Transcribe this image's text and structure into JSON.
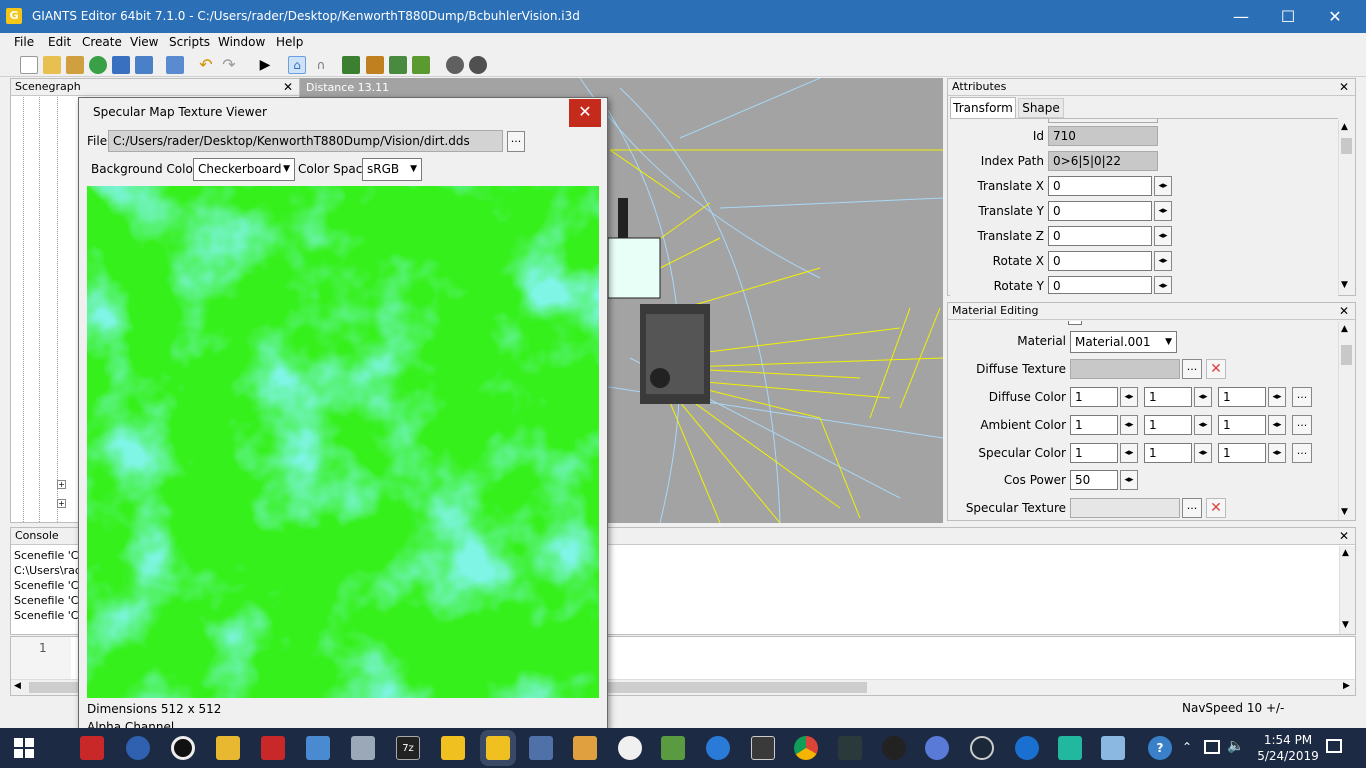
{
  "window": {
    "title": "GIANTS Editor 64bit 7.1.0 - C:/Users/rader/Desktop/KenworthT880Dump/BcbuhlerVision.i3d",
    "app_icon": "giants-logo-icon",
    "minimize": "—",
    "maximize": "☐",
    "close": "✕"
  },
  "menu": [
    "File",
    "Edit",
    "Create",
    "View",
    "Scripts",
    "Window",
    "Help"
  ],
  "toolbar": {
    "icons": [
      "new-file-icon",
      "open-folder-icon",
      "edit-icon",
      "refresh-icon",
      "save-icon",
      "export-icon",
      "import-icon",
      "undo-icon",
      "redo-icon",
      "play-icon",
      "home-icon",
      "magnet-icon",
      "terrain-icon",
      "paint-icon",
      "foliage-icon",
      "tree-icon",
      "camera-icon",
      "settings-icon"
    ]
  },
  "scenegraph": {
    "title": "Scenegraph",
    "close": "✕"
  },
  "viewport": {
    "distance_label": "Distance 13.11"
  },
  "attributes": {
    "title": "Attributes",
    "close": "✕",
    "tabs": [
      "Transform",
      "Shape"
    ],
    "active_tab": "Transform",
    "rows": [
      {
        "label": "Id",
        "value": "710",
        "readonly": true
      },
      {
        "label": "Index Path",
        "value": "0>6|5|0|22",
        "readonly": true
      },
      {
        "label": "Translate X",
        "value": "0"
      },
      {
        "label": "Translate Y",
        "value": "0"
      },
      {
        "label": "Translate Z",
        "value": "0"
      },
      {
        "label": "Rotate X",
        "value": "0"
      },
      {
        "label": "Rotate Y",
        "value": "0"
      }
    ]
  },
  "material_editing": {
    "title": "Material Editing",
    "close": "✕",
    "material_label": "Material",
    "material_value": "Material.001",
    "diffuse_texture_label": "Diffuse Texture",
    "diffuse_color_label": "Diffuse Color",
    "diffuse_color": [
      "1",
      "1",
      "1"
    ],
    "ambient_color_label": "Ambient Color",
    "ambient_color": [
      "1",
      "1",
      "1"
    ],
    "specular_color_label": "Specular Color",
    "specular_color": [
      "1",
      "1",
      "1"
    ],
    "cos_power_label": "Cos Power",
    "cos_power": "50",
    "specular_texture_label": "Specular Texture",
    "dots": "...",
    "clear": "✕"
  },
  "console": {
    "title": "Console",
    "close": "✕",
    "lines": [
      "Scenefile 'C:",
      "C:\\Users\\rad",
      "Scenefile 'C:",
      "Scenefile 'C:",
      "Scenefile 'C:"
    ]
  },
  "script_editor": {
    "line_number": "1"
  },
  "statusbar": {
    "navspeed": "NavSpeed 10 +/-"
  },
  "texture_viewer": {
    "title": "Specular Map Texture Viewer",
    "close": "✕",
    "file_label": "File",
    "file_path": "C:/Users/rader/Desktop/KenworthT880Dump/Vision/dirt.dds",
    "browse": "...",
    "bg_color_label": "Background Color",
    "bg_color_value": "Checkerboard",
    "color_space_label": "Color Space",
    "color_space_value": "sRGB",
    "dimensions": "Dimensions 512 x 512",
    "alpha_channel": "Alpha Channel",
    "texture_colors": {
      "primary": "#36f01c",
      "secondary": "#35e8c8"
    }
  },
  "taskbar": {
    "time": "1:54 PM",
    "date": "5/24/2019",
    "icons": [
      "windows-start-icon",
      "giants-editor-icon",
      "vpn-icon",
      "record-icon",
      "file-explorer-icon",
      "giants-icon",
      "control-panel-icon",
      "scanner-icon",
      "7zip-icon",
      "giants-folder-icon",
      "giants-active-icon",
      "paint-icon",
      "media-player-icon",
      "itunes-icon",
      "notepad-icon",
      "internet-explorer-icon",
      "calculator-icon",
      "chrome-icon",
      "gimp-icon",
      "obs-icon",
      "chromium-icon",
      "steam-icon",
      "edge-icon",
      "game-icon",
      "notes-icon"
    ],
    "tray": [
      "help-icon",
      "chevron-up-icon",
      "network-icon",
      "volume-icon"
    ],
    "notification_icon": "notification-icon"
  }
}
